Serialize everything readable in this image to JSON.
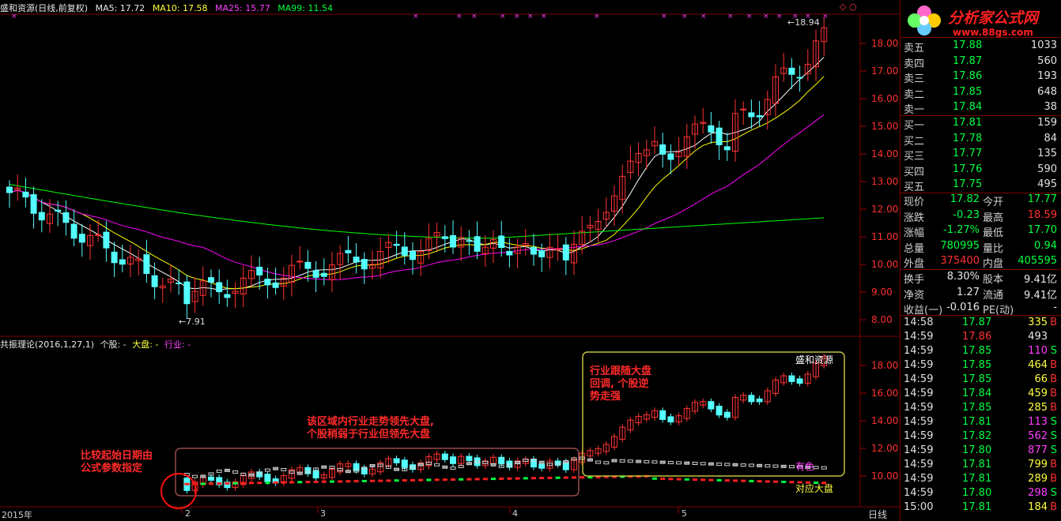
{
  "header": {
    "stock_title": "盛和资源(日线,前复权)",
    "ma5": "MA5: 17.72",
    "ma10": "MA10: 17.58",
    "ma25": "MA25: 15.77",
    "ma99": "MA99: 11.54",
    "ma5_color": "#ffffff",
    "ma10_color": "#ffff00",
    "ma25_color": "#ff00ff",
    "ma99_color": "#00ff00"
  },
  "price_axis": [
    "18.00",
    "17.00",
    "16.00",
    "15.00",
    "14.00",
    "13.00",
    "12.00",
    "11.00",
    "10.00",
    "9.00",
    "8.00"
  ],
  "price_markers": {
    "high": "18.94",
    "low": "7.91"
  },
  "indicator": {
    "title": "共振理论(2016,1,27,1)",
    "stock": "个股: -",
    "market": "大盘: -",
    "industry": "行业: -",
    "axis": [
      "18.00",
      "16.00",
      "14.00",
      "12.00",
      "10.00"
    ]
  },
  "annotations": {
    "start_note": [
      "比较起始日期由",
      "公式参数指定"
    ],
    "middle_note": [
      "该区域内行业走势领先大盘,",
      "个股稍弱于行业但领先大盘"
    ],
    "right_note": [
      "行业跟随大盘",
      "回调, 个股逆",
      "势走强"
    ],
    "label_stock": "盛和资源",
    "label_industry": "有色",
    "label_market": "对应大盘"
  },
  "x_axis": {
    "year": "2015年",
    "months": [
      "2",
      "3",
      "4",
      "5"
    ],
    "period": "日线"
  },
  "logo": {
    "name": "分析家公式网",
    "url": "www.88gs.com"
  },
  "order_book": {
    "asks": [
      {
        "label": "卖五",
        "price": "17.88",
        "vol": "1033"
      },
      {
        "label": "卖四",
        "price": "17.87",
        "vol": "560"
      },
      {
        "label": "卖三",
        "price": "17.86",
        "vol": "193"
      },
      {
        "label": "卖二",
        "price": "17.85",
        "vol": "648"
      },
      {
        "label": "卖一",
        "price": "17.84",
        "vol": "38"
      }
    ],
    "bids": [
      {
        "label": "买一",
        "price": "17.81",
        "vol": "159"
      },
      {
        "label": "买二",
        "price": "17.78",
        "vol": "84"
      },
      {
        "label": "买三",
        "price": "17.77",
        "vol": "135"
      },
      {
        "label": "买四",
        "price": "17.76",
        "vol": "590"
      },
      {
        "label": "买五",
        "price": "17.75",
        "vol": "495"
      }
    ]
  },
  "stats": [
    {
      "k1": "现价",
      "v1": "17.82",
      "k2": "今开",
      "v2": "17.77"
    },
    {
      "k1": "涨跌",
      "v1": "-0.23",
      "k2": "最高",
      "v2": "18.59"
    },
    {
      "k1": "涨幅",
      "v1": "-1.27%",
      "k2": "最低",
      "v2": "17.70"
    },
    {
      "k1": "总量",
      "v1": "780995",
      "k2": "量比",
      "v2": "0.94"
    },
    {
      "k1": "外盘",
      "v1": "375400",
      "k2": "内盘",
      "v2": "405595"
    },
    {
      "k1": "换手",
      "v1": "8.30%",
      "k2": "股本",
      "v2": "9.41亿"
    },
    {
      "k1": "净资",
      "v1": "1.27",
      "k2": "流通",
      "v2": "9.41亿"
    },
    {
      "k1": "收益(一)",
      "v1": "-0.016",
      "k2": "PE(动)",
      "v2": "-"
    }
  ],
  "ticks": [
    {
      "time": "14:58",
      "price": "17.87",
      "vol": "335",
      "side": "B"
    },
    {
      "time": "14:59",
      "price": "17.86",
      "vol": "493",
      "side": ""
    },
    {
      "time": "14:59",
      "price": "17.85",
      "vol": "110",
      "side": "S"
    },
    {
      "time": "14:59",
      "price": "17.85",
      "vol": "464",
      "side": "B"
    },
    {
      "time": "14:59",
      "price": "17.85",
      "vol": "66",
      "side": "B"
    },
    {
      "time": "14:59",
      "price": "17.84",
      "vol": "459",
      "side": "B"
    },
    {
      "time": "14:59",
      "price": "17.85",
      "vol": "285",
      "side": "B"
    },
    {
      "time": "14:59",
      "price": "17.81",
      "vol": "113",
      "side": "S"
    },
    {
      "time": "14:59",
      "price": "17.82",
      "vol": "562",
      "side": "S"
    },
    {
      "time": "14:59",
      "price": "17.80",
      "vol": "877",
      "side": "S"
    },
    {
      "time": "14:59",
      "price": "17.81",
      "vol": "799",
      "side": "B"
    },
    {
      "time": "14:59",
      "price": "17.81",
      "vol": "289",
      "side": "B"
    },
    {
      "time": "14:59",
      "price": "17.80",
      "vol": "298",
      "side": "S"
    },
    {
      "time": "15:00",
      "price": "17.81",
      "vol": "184",
      "side": "B"
    }
  ]
}
